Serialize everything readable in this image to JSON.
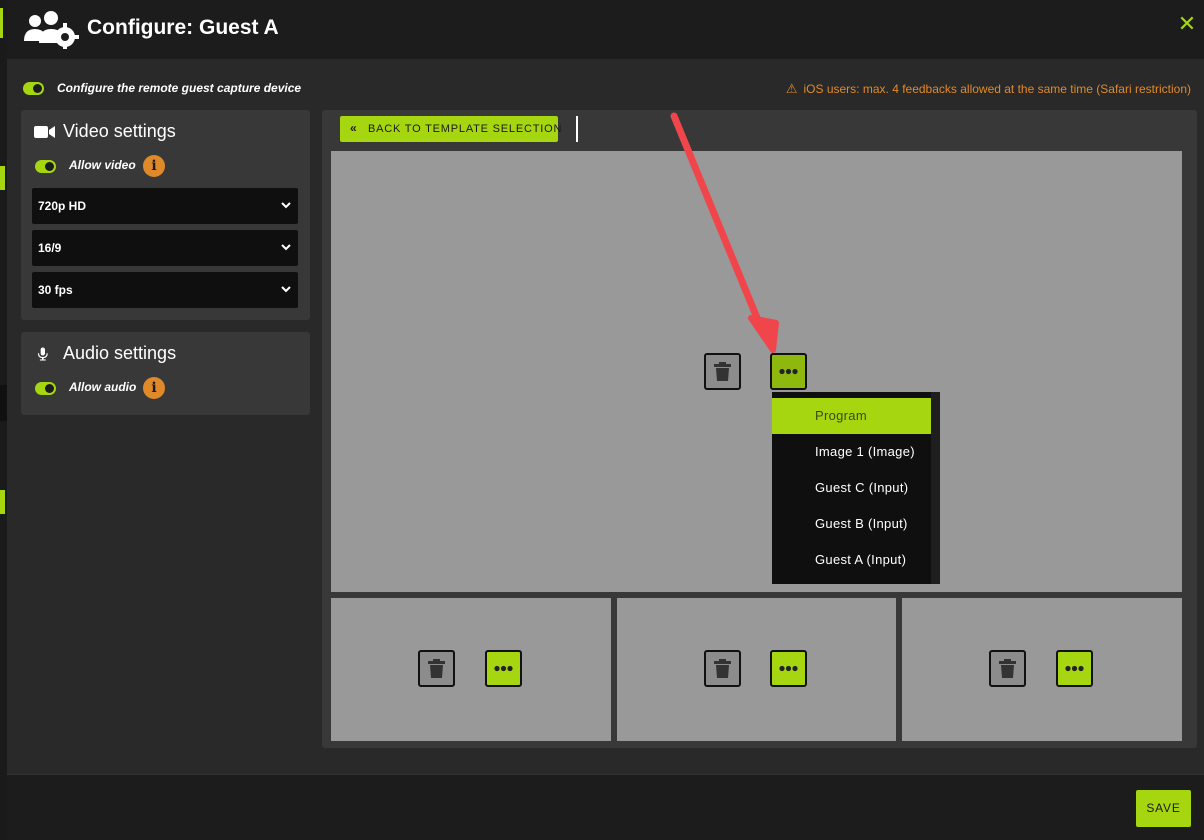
{
  "header": {
    "title": "Configure: Guest A",
    "logo_icon": "users-gear-icon",
    "close_icon": "close-icon"
  },
  "capture_toggle": {
    "label": "Configure the remote guest capture device",
    "on": true
  },
  "ios_warning": {
    "icon": "warning-icon",
    "text": "iOS users: max. 4 feedbacks allowed at the same time (Safari restriction)"
  },
  "video_settings": {
    "title": "Video settings",
    "icon": "video-camera-icon",
    "allow_label": "Allow video",
    "allow_on": true,
    "info_icon": "info-icon",
    "resolution": "720p HD",
    "aspect_ratio": "16/9",
    "framerate": "30 fps"
  },
  "audio_settings": {
    "title": "Audio settings",
    "icon": "microphone-icon",
    "allow_label": "Allow audio",
    "allow_on": true,
    "info_icon": "info-icon"
  },
  "layout_editor": {
    "back_label": "BACK TO TEMPLATE SELECTION",
    "slot_actions": {
      "delete_icon": "trash-icon",
      "options_icon": "more-dots-icon"
    },
    "source_menu": {
      "items": [
        "Program",
        "Image 1 (Image)",
        "Guest C (Input)",
        "Guest B (Input)",
        "Guest A (Input)"
      ],
      "selected": "Program"
    }
  },
  "footer": {
    "save_label": "SAVE"
  },
  "colors": {
    "accent": "#a5d610",
    "warning": "#e0892a",
    "panel": "#383838",
    "slot": "#999999",
    "annotation_arrow": "#f0454a"
  }
}
